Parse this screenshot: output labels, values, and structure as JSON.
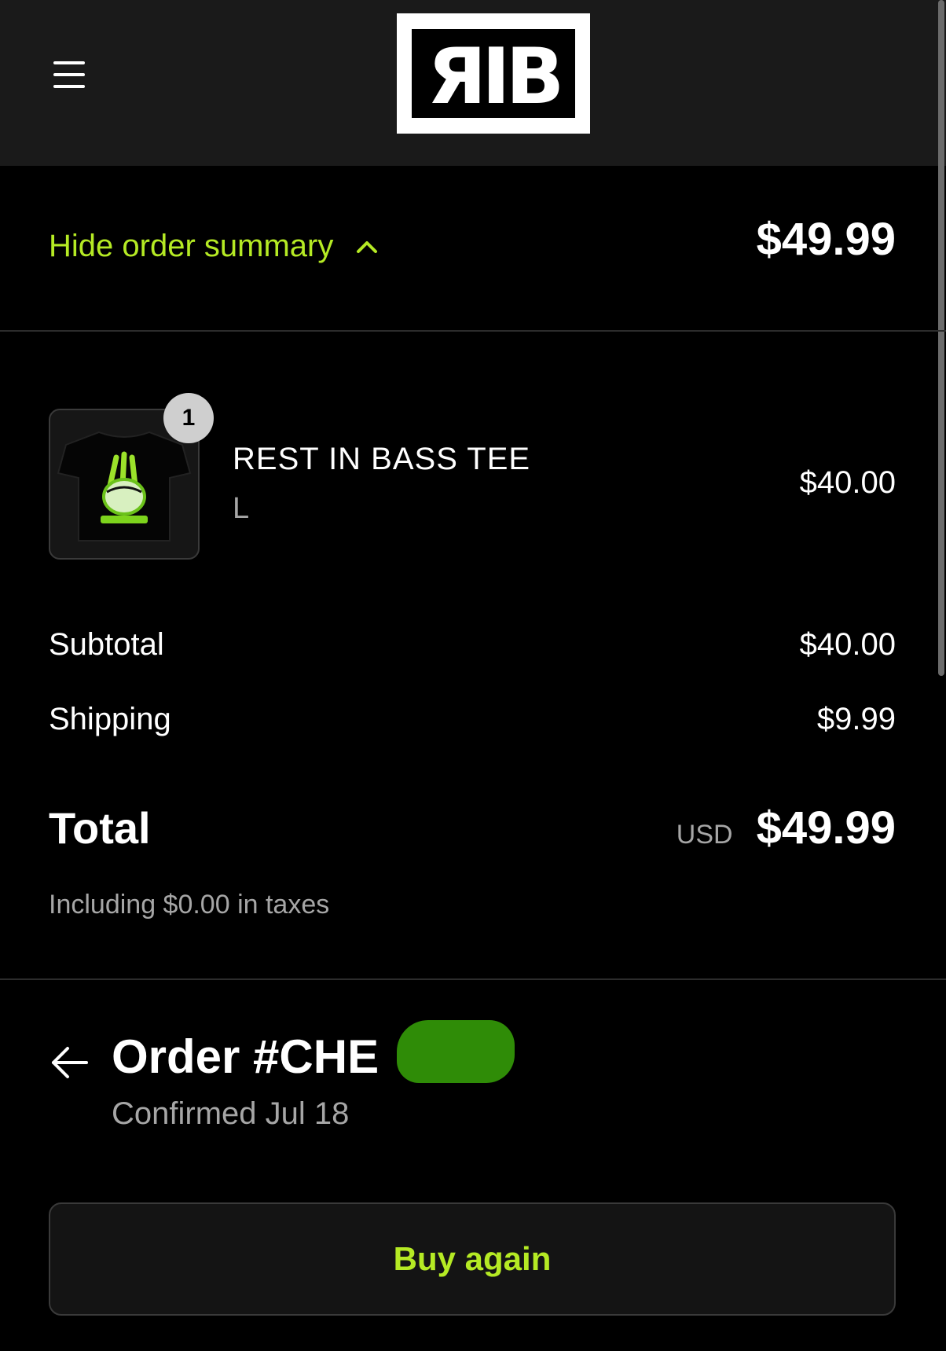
{
  "header": {
    "logo_text": "RIB",
    "menu_icon": "hamburger-menu-icon"
  },
  "summary": {
    "toggle_label": "Hide order summary",
    "toggle_icon": "chevron-up-icon",
    "total": "$49.99"
  },
  "line_item": {
    "quantity": "1",
    "name": "REST IN BASS TEE",
    "variant": "L",
    "price": "$40.00",
    "image": "black-tee-with-green-peace-hand-graphic"
  },
  "totals": {
    "subtotal_label": "Subtotal",
    "subtotal_value": "$40.00",
    "shipping_label": "Shipping",
    "shipping_value": "$9.99",
    "total_label": "Total",
    "currency": "USD",
    "total_value": "$49.99",
    "taxes_note": "Including $0.00 in taxes"
  },
  "order": {
    "title": "Order #CHE",
    "confirmed": "Confirmed Jul 18",
    "back_icon": "arrow-left-icon"
  },
  "actions": {
    "buy_again_label": "Buy again"
  },
  "colors": {
    "accent": "#b5ea24",
    "header_bg": "#1a1a1a",
    "page_bg": "#000000",
    "muted_text": "#a6a6a6",
    "redaction": "#2f8c07"
  }
}
